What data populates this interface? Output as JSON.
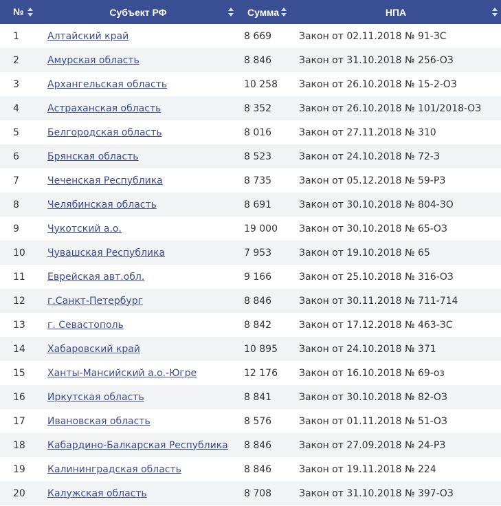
{
  "headers": {
    "num": "№",
    "subject": "Субъект РФ",
    "sum": "Сумма",
    "npa": "НПА"
  },
  "rows": [
    {
      "num": "1",
      "subject": "Алтайский край",
      "sum": "8 669",
      "npa": "Закон от 02.11.2018 № 91-ЗС"
    },
    {
      "num": "2",
      "subject": "Амурская область",
      "sum": "8 846",
      "npa": "Закон от 31.10.2018 № 256-ОЗ"
    },
    {
      "num": "3",
      "subject": "Архангельская область",
      "sum": "10 258",
      "npa": "Закон от 26.10.2018 № 15-2-ОЗ"
    },
    {
      "num": "4",
      "subject": "Астраханская область",
      "sum": "8 352",
      "npa": "Закон от 26.10.2018 № 101/2018-ОЗ"
    },
    {
      "num": "5",
      "subject": "Белгородская область",
      "sum": "8 016",
      "npa": "Закон от 27.11.2018 № 310"
    },
    {
      "num": "6",
      "subject": "Брянская область",
      "sum": "8 523",
      "npa": "Закон от 24.10.2018 № 72-З"
    },
    {
      "num": "7",
      "subject": "Чеченская Республика",
      "sum": "8 735",
      "npa": "Закон от 05.12.2018 № 59-РЗ"
    },
    {
      "num": "8",
      "subject": "Челябинская область",
      "sum": "8 691",
      "npa": "Закон от 30.10.2018 № 804-ЗО"
    },
    {
      "num": "9",
      "subject": "Чукотский а.о.",
      "sum": "19 000",
      "npa": "Закон от 30.10.2018 № 65-ОЗ"
    },
    {
      "num": "10",
      "subject": "Чувашская Республика",
      "sum": "7 953",
      "npa": "Закон от 19.10.2018 № 65"
    },
    {
      "num": "11",
      "subject": "Еврейская авт.обл.",
      "sum": "9 166",
      "npa": "Закон от 25.10.2018 № 316-ОЗ"
    },
    {
      "num": "12",
      "subject": "г.Санкт-Петербург",
      "sum": "8 846",
      "npa": "Закон от 30.11.2018 № 711-714"
    },
    {
      "num": "13",
      "subject": "г. Севастополь",
      "sum": "8 842",
      "npa": "Закон от 17.12.2018 № 463-ЗС"
    },
    {
      "num": "14",
      "subject": "Хабаровский край",
      "sum": "10 895",
      "npa": "Закон от 24.10.2018 № 371"
    },
    {
      "num": "15",
      "subject": "Ханты-Мансийский а.о.-Югре",
      "sum": "12 176",
      "npa": "Закон от 16.10.2018 № 69-оз"
    },
    {
      "num": "16",
      "subject": "Иркутская область",
      "sum": "8 841",
      "npa": "Закон от 30.10.2018 № 82-ОЗ"
    },
    {
      "num": "17",
      "subject": "Ивановская область",
      "sum": "8 576",
      "npa": "Закон от 01.11.2018 № 51-ОЗ"
    },
    {
      "num": "18",
      "subject": "Кабардино-Балкарская Республика",
      "sum": "8 846",
      "npa": "Закон от 27.09.2018 № 24-РЗ"
    },
    {
      "num": "19",
      "subject": "Калининградская область",
      "sum": "8 846",
      "npa": "Закон от 19.11.2018 № 224"
    },
    {
      "num": "20",
      "subject": "Калужская область",
      "sum": "8 708",
      "npa": "Закон от 31.10.2018 № 397-ОЗ"
    }
  ],
  "colors": {
    "header_bg": "#3a4e94",
    "link": "#3d4e8e",
    "stripe": "#f1f3f5"
  }
}
